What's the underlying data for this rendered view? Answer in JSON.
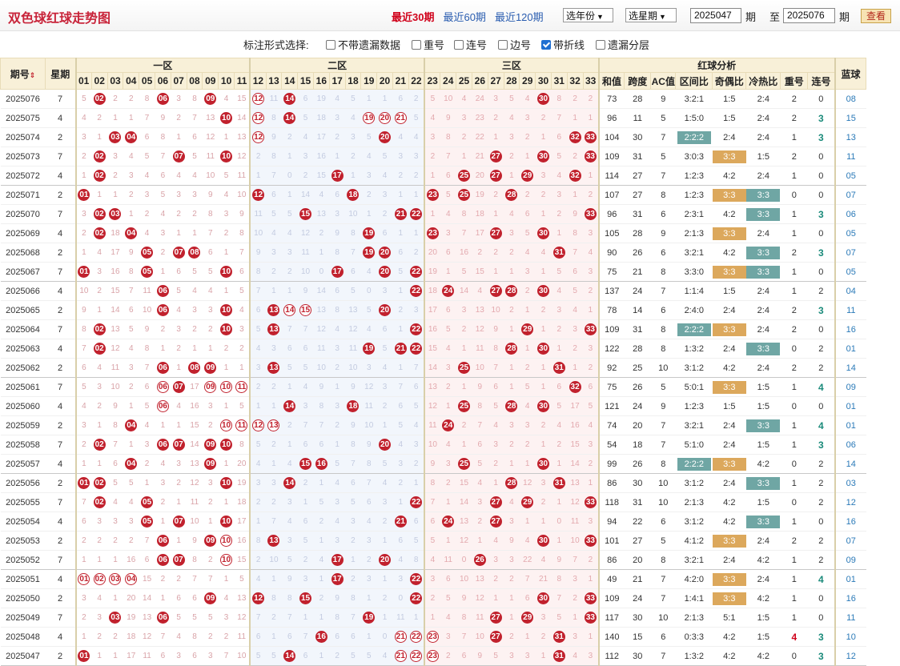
{
  "header": {
    "title": "双色球红球走势图",
    "periods": [
      "最近30期",
      "最近60期",
      "最近120期"
    ],
    "active_period": "最近30期",
    "year_select": "选年份",
    "week_select": "选星期",
    "from_issue": "2025047",
    "from_suffix": "期",
    "to_prefix": "至",
    "to_issue": "2025076",
    "to_suffix": "期",
    "query_button": "查看"
  },
  "options": {
    "label": "标注形式选择:",
    "items": [
      {
        "label": "不带遗漏数据",
        "checked": false
      },
      {
        "label": "重号",
        "checked": false
      },
      {
        "label": "连号",
        "checked": false
      },
      {
        "label": "边号",
        "checked": false
      },
      {
        "label": "带折线",
        "checked": true
      },
      {
        "label": "遗漏分层",
        "checked": false
      }
    ]
  },
  "table": {
    "headers": {
      "issue": "期号",
      "week": "星期",
      "zone1": "一区",
      "zone2": "二区",
      "zone3": "三区",
      "analysis": "红球分析",
      "blue": "蓝球",
      "analysis_cols": [
        "和值",
        "跨度",
        "AC值",
        "区间比",
        "奇偶比",
        "冷热比",
        "重号",
        "连号"
      ],
      "balls": [
        "01",
        "02",
        "03",
        "04",
        "05",
        "06",
        "07",
        "08",
        "09",
        "10",
        "11",
        "12",
        "13",
        "14",
        "15",
        "16",
        "17",
        "18",
        "19",
        "20",
        "21",
        "22",
        "23",
        "24",
        "25",
        "26",
        "27",
        "28",
        "29",
        "30",
        "31",
        "32",
        "33"
      ]
    },
    "rows": [
      {
        "issue": "2025076",
        "week": "7",
        "reds": [
          2,
          6,
          9,
          12,
          14,
          30
        ],
        "omit": "5,0,2,2,8,0,3,8,0,4,15,0,11,0,6,19,4,5,1,1,6,2,5,10,4,24,3,5,4,0,8,2,2",
        "he": "73",
        "kua": "28",
        "ac": "9",
        "qj": "3:2:1",
        "jo": "1:5",
        "lr": "2:4",
        "chong": "2",
        "lian": "0",
        "blue": "08"
      },
      {
        "issue": "2025075",
        "week": "4",
        "reds": [
          10,
          12,
          14,
          19,
          20,
          21
        ],
        "omit": "4,2,1,1,7,9,2,7,13,0,14,0,8,0,5,18,3,4,0,0,0,5,4,9,3,23,2,4,3,2,7,1,1",
        "he": "96",
        "kua": "11",
        "ac": "5",
        "qj": "1:5:0",
        "jo": "1:5",
        "lr": "2:4",
        "chong": "2",
        "lian": "3",
        "blue": "15"
      },
      {
        "issue": "2025074",
        "week": "2",
        "reds": [
          3,
          4,
          12,
          20,
          32,
          33
        ],
        "omit": "3,1,0,0,6,8,1,6,12,1,13,0,9,2,4,17,2,3,5,0,4,4,3,8,2,22,1,3,2,1,6,0,0",
        "he": "104",
        "kua": "30",
        "ac": "7",
        "qj": "2:2:2",
        "jo": "2:4",
        "lr": "2:4",
        "chong": "1",
        "lian": "3",
        "blue": "13"
      },
      {
        "issue": "2025073",
        "week": "7",
        "reds": [
          2,
          7,
          10,
          27,
          30,
          33
        ],
        "omit": "2,0,3,4,5,7,0,5,11,0,12,2,8,1,3,16,1,2,4,5,3,3,2,7,1,21,0,2,1,0,5,2,0",
        "he": "109",
        "kua": "31",
        "ac": "5",
        "qj": "3:0:3",
        "jo": "3:3",
        "lr": "1:5",
        "chong": "2",
        "lian": "0",
        "blue": "11"
      },
      {
        "issue": "2025072",
        "week": "4",
        "reds": [
          2,
          17,
          25,
          27,
          29,
          32
        ],
        "omit": "1,0,2,3,4,6,4,4,10,5,11,1,7,0,2,15,0,1,3,4,2,2,1,6,0,20,0,1,0,3,4,0,1",
        "he": "114",
        "kua": "27",
        "ac": "7",
        "qj": "1:2:3",
        "jo": "4:2",
        "lr": "2:4",
        "chong": "1",
        "lian": "0",
        "blue": "05"
      },
      {
        "issue": "2025071",
        "week": "2",
        "reds": [
          1,
          12,
          18,
          23,
          25,
          28
        ],
        "omit": "0,1,1,2,3,5,3,3,9,4,10,0,6,1,14,4,6,0,2,3,1,1,0,5,0,19,2,0,2,2,3,1,2",
        "he": "107",
        "kua": "27",
        "ac": "8",
        "qj": "1:2:3",
        "jo": "3:3",
        "lr": "3:3",
        "chong": "0",
        "lian": "0",
        "blue": "07"
      },
      {
        "issue": "2025070",
        "week": "7",
        "reds": [
          2,
          3,
          15,
          21,
          22,
          33
        ],
        "omit": "3,0,0,1,2,4,2,2,8,3,9,11,5,5,0,13,3,10,1,2,0,0,1,4,8,18,1,4,6,1,2,9,0",
        "he": "96",
        "kua": "31",
        "ac": "6",
        "qj": "2:3:1",
        "jo": "4:2",
        "lr": "3:3",
        "chong": "1",
        "lian": "3",
        "blue": "06"
      },
      {
        "issue": "2025069",
        "week": "4",
        "reds": [
          2,
          4,
          19,
          23,
          27,
          30
        ],
        "omit": "2,0,18,0,4,3,1,1,7,2,8,10,4,4,12,2,9,8,0,6,1,1,0,3,7,17,0,3,5,0,1,8,3",
        "he": "105",
        "kua": "28",
        "ac": "9",
        "qj": "2:1:3",
        "jo": "3:3",
        "lr": "2:4",
        "chong": "1",
        "lian": "0",
        "blue": "05"
      },
      {
        "issue": "2025068",
        "week": "2",
        "reds": [
          5,
          7,
          8,
          19,
          20,
          31
        ],
        "omit": "1,4,17,9,0,2,0,0,6,1,7,9,3,3,11,1,8,7,0,0,6,2,20,6,16,2,2,2,4,4,0,7,4",
        "he": "90",
        "kua": "26",
        "ac": "6",
        "qj": "3:2:1",
        "jo": "4:2",
        "lr": "3:3",
        "chong": "2",
        "lian": "3",
        "blue": "07"
      },
      {
        "issue": "2025067",
        "week": "7",
        "reds": [
          1,
          5,
          10,
          17,
          20,
          22
        ],
        "omit": "0,3,16,8,0,1,6,5,5,0,6,8,2,2,10,0,0,6,4,0,5,0,19,1,5,15,1,1,3,1,5,6,3",
        "he": "75",
        "kua": "21",
        "ac": "8",
        "qj": "3:3:0",
        "jo": "3:3",
        "lr": "3:3",
        "chong": "1",
        "lian": "0",
        "blue": "05"
      },
      {
        "issue": "2025066",
        "week": "4",
        "reds": [
          6,
          22,
          24,
          27,
          28,
          30
        ],
        "omit": "10,2,15,7,11,0,5,4,4,1,5,7,1,1,9,14,6,5,0,3,1,0,18,0,14,4,0,0,2,0,4,5,2",
        "he": "137",
        "kua": "24",
        "ac": "7",
        "qj": "1:1:4",
        "jo": "1:5",
        "lr": "2:4",
        "chong": "1",
        "lian": "2",
        "blue": "04"
      },
      {
        "issue": "2025065",
        "week": "2",
        "reds": [
          6,
          10,
          13,
          14,
          15,
          20
        ],
        "omit": "9,1,14,6,10,0,4,3,3,0,4,6,0,0,0,13,8,13,5,0,2,3,17,6,3,13,10,2,1,2,3,4,1",
        "he": "78",
        "kua": "14",
        "ac": "6",
        "qj": "2:4:0",
        "jo": "2:4",
        "lr": "2:4",
        "chong": "2",
        "lian": "3",
        "blue": "11"
      },
      {
        "issue": "2025064",
        "week": "7",
        "reds": [
          2,
          10,
          13,
          22,
          29,
          33
        ],
        "omit": "8,0,13,5,9,2,3,2,2,0,3,5,0,7,7,12,4,12,4,6,1,0,16,5,2,12,9,1,0,1,2,3,0",
        "he": "109",
        "kua": "31",
        "ac": "8",
        "qj": "2:2:2",
        "jo": "3:3",
        "lr": "2:4",
        "chong": "2",
        "lian": "0",
        "blue": "16"
      },
      {
        "issue": "2025063",
        "week": "4",
        "reds": [
          2,
          19,
          21,
          22,
          28,
          30
        ],
        "omit": "7,0,12,4,8,1,2,1,1,2,2,4,3,6,6,11,3,11,0,5,0,0,15,4,1,11,8,0,1,0,1,2,3",
        "he": "122",
        "kua": "28",
        "ac": "8",
        "qj": "1:3:2",
        "jo": "2:4",
        "lr": "3:3",
        "chong": "0",
        "lian": "2",
        "blue": "01"
      },
      {
        "issue": "2025062",
        "week": "2",
        "reds": [
          6,
          8,
          9,
          13,
          25,
          31
        ],
        "omit": "6,4,11,3,7,0,1,0,0,1,1,3,0,5,5,10,2,10,3,4,1,7,14,3,0,10,7,1,2,1,0,1,2",
        "he": "92",
        "kua": "25",
        "ac": "10",
        "qj": "3:1:2",
        "jo": "4:2",
        "lr": "2:4",
        "chong": "2",
        "lian": "2",
        "blue": "14"
      },
      {
        "issue": "2025061",
        "week": "7",
        "reds": [
          6,
          7,
          9,
          10,
          11,
          32
        ],
        "omit": "5,3,10,2,6,0,0,17,0,0,0,2,2,1,4,9,1,9,12,3,7,6,13,2,1,9,6,1,5,1,6,0,6",
        "he": "75",
        "kua": "26",
        "ac": "5",
        "qj": "5:0:1",
        "jo": "3:3",
        "lr": "1:5",
        "chong": "1",
        "lian": "4",
        "blue": "09"
      },
      {
        "issue": "2025060",
        "week": "4",
        "reds": [
          6,
          14,
          18,
          25,
          28,
          30
        ],
        "omit": "4,2,9,1,5,0,4,16,3,1,5,1,1,0,3,8,3,0,11,2,6,5,12,1,0,8,5,0,4,0,5,17,5",
        "he": "121",
        "kua": "24",
        "ac": "9",
        "qj": "1:2:3",
        "jo": "1:5",
        "lr": "1:5",
        "chong": "0",
        "lian": "0",
        "blue": "01"
      },
      {
        "issue": "2025059",
        "week": "2",
        "reds": [
          4,
          10,
          11,
          12,
          13,
          24
        ],
        "omit": "3,1,8,0,4,1,1,15,2,0,0,0,0,2,7,7,2,9,10,1,5,4,11,0,2,7,4,3,3,2,4,16,4",
        "he": "74",
        "kua": "20",
        "ac": "7",
        "qj": "3:2:1",
        "jo": "2:4",
        "lr": "3:3",
        "chong": "1",
        "lian": "4",
        "blue": "01"
      },
      {
        "issue": "2025058",
        "week": "7",
        "reds": [
          2,
          6,
          7,
          9,
          10,
          20
        ],
        "omit": "2,0,7,1,3,0,0,14,0,0,8,5,2,1,6,6,1,8,9,0,4,3,10,4,1,6,3,2,2,1,2,15,3",
        "he": "54",
        "kua": "18",
        "ac": "7",
        "qj": "5:1:0",
        "jo": "2:4",
        "lr": "1:5",
        "chong": "1",
        "lian": "3",
        "blue": "06"
      },
      {
        "issue": "2025057",
        "week": "4",
        "reds": [
          4,
          9,
          15,
          16,
          25,
          30
        ],
        "omit": "1,1,6,0,2,4,3,13,0,1,20,4,1,4,0,0,5,7,8,5,3,2,9,3,0,5,2,1,1,0,1,14,2",
        "he": "99",
        "kua": "26",
        "ac": "8",
        "qj": "2:2:2",
        "jo": "3:3",
        "lr": "4:2",
        "chong": "0",
        "lian": "2",
        "blue": "14"
      },
      {
        "issue": "2025056",
        "week": "2",
        "reds": [
          1,
          2,
          10,
          14,
          28,
          31
        ],
        "omit": "0,0,5,5,1,3,2,12,3,0,19,3,3,0,2,1,4,6,7,4,2,1,8,2,15,4,1,0,12,3,0,13,1",
        "he": "86",
        "kua": "30",
        "ac": "10",
        "qj": "3:1:2",
        "jo": "2:4",
        "lr": "3:3",
        "chong": "1",
        "lian": "2",
        "blue": "03"
      },
      {
        "issue": "2025055",
        "week": "7",
        "reds": [
          2,
          5,
          22,
          27,
          29,
          33
        ],
        "omit": "7,0,4,4,0,2,1,11,2,1,18,2,2,3,1,5,3,5,6,3,1,0,7,1,14,3,0,4,0,2,1,12,0",
        "he": "118",
        "kua": "31",
        "ac": "10",
        "qj": "2:1:3",
        "jo": "4:2",
        "lr": "1:5",
        "chong": "0",
        "lian": "2",
        "blue": "12"
      },
      {
        "issue": "2025054",
        "week": "4",
        "reds": [
          5,
          7,
          10,
          21,
          24,
          27
        ],
        "omit": "6,3,3,3,0,1,0,10,1,0,17,1,7,4,6,2,4,3,4,2,0,6,6,0,13,2,0,3,1,1,0,11,3",
        "he": "94",
        "kua": "22",
        "ac": "6",
        "qj": "3:1:2",
        "jo": "4:2",
        "lr": "3:3",
        "chong": "1",
        "lian": "0",
        "blue": "16"
      },
      {
        "issue": "2025053",
        "week": "2",
        "reds": [
          6,
          9,
          10,
          13,
          30,
          33
        ],
        "omit": "2,2,2,2,7,0,1,9,0,0,16,8,0,3,5,1,3,2,3,1,6,5,5,1,12,1,4,9,4,0,1,10,0",
        "he": "101",
        "kua": "27",
        "ac": "5",
        "qj": "4:1:2",
        "jo": "3:3",
        "lr": "2:4",
        "chong": "2",
        "lian": "2",
        "blue": "07"
      },
      {
        "issue": "2025052",
        "week": "7",
        "reds": [
          6,
          7,
          10,
          17,
          20,
          26
        ],
        "omit": "1,1,1,16,6,0,0,8,2,0,15,2,10,5,2,4,0,1,2,0,4,8,4,11,0,0,3,3,22,4,9,7,2",
        "he": "86",
        "kua": "20",
        "ac": "8",
        "qj": "3:2:1",
        "jo": "2:4",
        "lr": "4:2",
        "chong": "1",
        "lian": "2",
        "blue": "09"
      },
      {
        "issue": "2025051",
        "week": "4",
        "reds": [
          1,
          2,
          3,
          4,
          17,
          22
        ],
        "omit": "0,0,0,0,15,2,2,7,7,1,5,4,1,9,3,1,0,2,3,1,3,0,3,6,10,13,2,2,7,21,8,3,1",
        "he": "49",
        "kua": "21",
        "ac": "7",
        "qj": "4:2:0",
        "jo": "3:3",
        "lr": "2:4",
        "chong": "1",
        "lian": "4",
        "blue": "01"
      },
      {
        "issue": "2025050",
        "week": "2",
        "reds": [
          9,
          12,
          15,
          22,
          33,
          30
        ],
        "omit": "3,4,1,20,14,1,6,6,0,4,13,0,8,8,0,2,9,8,1,2,0,0,2,5,9,12,1,1,6,20,7,2,0",
        "he": "109",
        "kua": "24",
        "ac": "7",
        "qj": "1:4:1",
        "jo": "3:3",
        "lr": "4:2",
        "chong": "1",
        "lian": "0",
        "blue": "16"
      },
      {
        "issue": "2025049",
        "week": "7",
        "reds": [
          3,
          6,
          19,
          27,
          29,
          33
        ],
        "omit": "2,3,0,19,13,0,5,5,5,3,12,7,2,7,1,1,8,7,0,1,11,1,1,4,8,11,0,1,0,3,5,1,0",
        "he": "117",
        "kua": "30",
        "ac": "10",
        "qj": "2:1:3",
        "jo": "5:1",
        "lr": "1:5",
        "chong": "1",
        "lian": "0",
        "blue": "11"
      },
      {
        "issue": "2025048",
        "week": "4",
        "reds": [
          16,
          21,
          22,
          23,
          27,
          31
        ],
        "omit": "1,2,2,18,12,7,4,8,2,2,11,6,1,6,7,0,6,6,1,0,0,0,0,3,7,10,0,2,1,2,0,3,1",
        "he": "140",
        "kua": "15",
        "ac": "6",
        "qj": "0:3:3",
        "jo": "4:2",
        "lr": "1:5",
        "chong": "4",
        "lian": "3",
        "blue": "10"
      },
      {
        "issue": "2025047",
        "week": "2",
        "reds": [
          1,
          14,
          21,
          22,
          23,
          31
        ],
        "omit": "0,1,1,17,11,6,3,6,3,7,10,5,5,0,6,1,2,5,5,4,0,0,0,2,6,9,5,3,3,1,0,4,3",
        "he": "112",
        "kua": "30",
        "ac": "7",
        "qj": "1:3:2",
        "jo": "4:2",
        "lr": "4:2",
        "chong": "0",
        "lian": "3",
        "blue": "12"
      }
    ],
    "repeat_marks": {
      "2025076": [
        12
      ],
      "2025075": [
        12,
        19,
        20,
        21
      ],
      "2025074": [
        12
      ],
      "2025065": [
        14,
        15
      ],
      "2025061": [
        6,
        9,
        10,
        11
      ],
      "2025060": [
        6
      ],
      "2025059": [
        10,
        11,
        12,
        13
      ],
      "2025053": [
        10
      ],
      "2025052": [
        10
      ],
      "2025051": [
        1,
        2,
        3,
        4
      ],
      "2025048": [
        21,
        22,
        23
      ],
      "2025047": [
        21,
        22,
        23
      ]
    },
    "colors": {
      "red_ball": "#c1212d",
      "blue_text": "#2b7ab8",
      "header_bg": "#f8f0d8",
      "tag_orange": "#dca85c",
      "tag_green": "#6fa6a4"
    }
  }
}
